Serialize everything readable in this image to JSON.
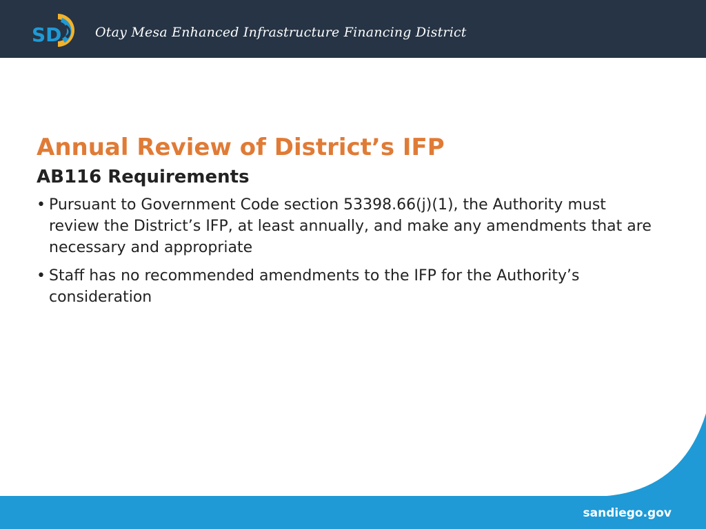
{
  "header": {
    "logo_text": "SD",
    "title": "Otay Mesa Enhanced Infrastructure Financing District"
  },
  "slide": {
    "title": "Annual Review of District’s IFP",
    "subtitle": "AB116 Requirements",
    "bullets": [
      "Pursuant to Government Code section 53398.66(j)(1), the Authority must review the District’s IFP, at least annually, and make any amendments that are necessary and appropriate",
      "Staff has no recommended amendments to the IFP for the Authority’s consideration"
    ],
    "bullet_symbol": "•"
  },
  "footer": {
    "url": "sandiego.gov"
  },
  "colors": {
    "header_bg": "#263445",
    "title_orange": "#e07b36",
    "footer_blue": "#1f9ad6"
  }
}
